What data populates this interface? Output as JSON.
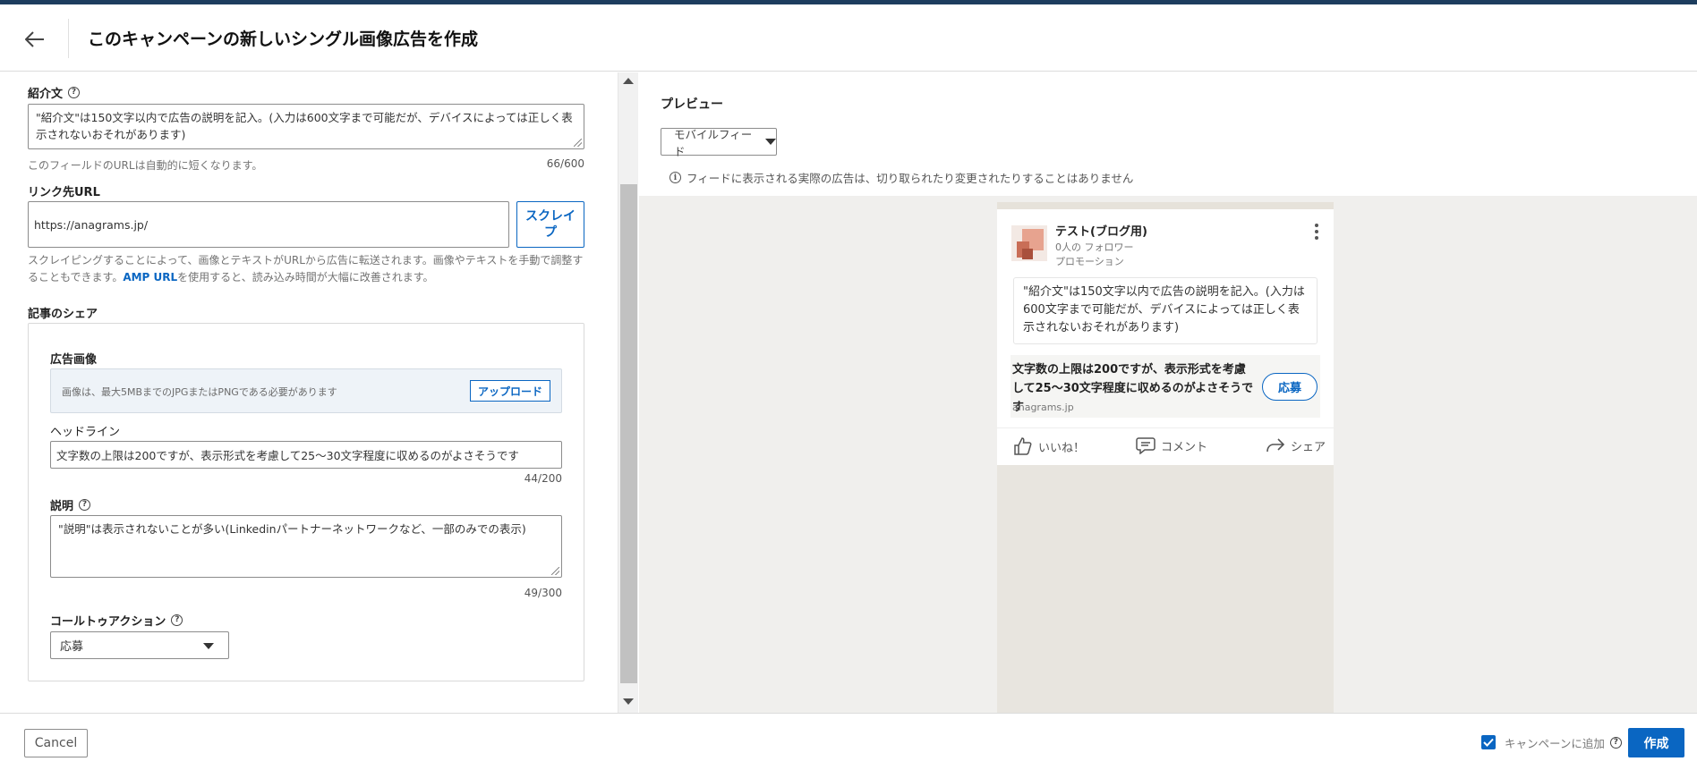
{
  "header": {
    "title": "このキャンペーンの新しいシングル画像広告を作成"
  },
  "form": {
    "intro": {
      "label": "紹介文",
      "value": "\"紹介文\"は150文字以内で広告の説明を記入。(入力は600文字まで可能だが、デバイスによっては正しく表示されないおそれがあります)",
      "helper": "このフィールドのURLは自動的に短くなります。",
      "counter": "66/600"
    },
    "url": {
      "label": "リンク先URL",
      "value": "https://anagrams.jp/",
      "scrape_button": "スクレイプ",
      "help_before": "スクレイピングすることによって、画像とテキストがURLから広告に転送されます。画像やテキストを手動で調整することもできます。",
      "help_link": "AMP URL",
      "help_after": "を使用すると、読み込み時間が大幅に改善されます。"
    },
    "article_share": {
      "label": "記事のシェア",
      "ad_image": {
        "label": "広告画像",
        "hint": "画像は、最大5MBまでのJPGまたはPNGである必要があります",
        "upload_button": "アップロード"
      },
      "headline": {
        "label": "ヘッドライン",
        "value": "文字数の上限は200ですが、表示形式を考慮して25～30文字程度に収めるのがよさそうです",
        "counter": "44/200"
      },
      "description": {
        "label": "説明",
        "value": "\"説明\"は表示されないことが多い(Linkedinパートナーネットワークなど、一部のみでの表示)",
        "counter": "49/300"
      },
      "cta": {
        "label": "コールトゥアクション",
        "selected": "応募"
      }
    }
  },
  "preview": {
    "title": "プレビュー",
    "feed_select": "モバイルフィード",
    "notice": "フィードに表示される実際の広告は、切り取られたり変更されたりすることはありません",
    "post": {
      "company": "テスト(ブログ用)",
      "followers": "0人の フォロワー",
      "promoted": "プロモーション",
      "text": "\"紹介文\"は150文字以内で広告の説明を記入。(入力は600文字まで可能だが、デバイスによっては正しく表示されないおそれがあります)",
      "headline": "文字数の上限は200ですが、表示形式を考慮して25～30文字程度に収めるのがよさそうです",
      "domain": "anagrams.jp",
      "cta": "応募",
      "like": "いいね！",
      "comment": "コメント",
      "share": "シェア"
    }
  },
  "footer": {
    "cancel": "Cancel",
    "add_to_campaign": "キャンペーンに追加",
    "create": "作成"
  },
  "icons": {
    "back": "arrow-left-icon",
    "help": "question-circle-icon",
    "info": "info-circle-icon",
    "more": "vertical-dots-icon",
    "like": "thumbs-up-icon",
    "comment": "comment-icon",
    "share": "share-arrow-icon",
    "check": "checkmark-icon"
  },
  "colors": {
    "accent": "#0a66c2",
    "top_bar": "#1d3d5e"
  }
}
